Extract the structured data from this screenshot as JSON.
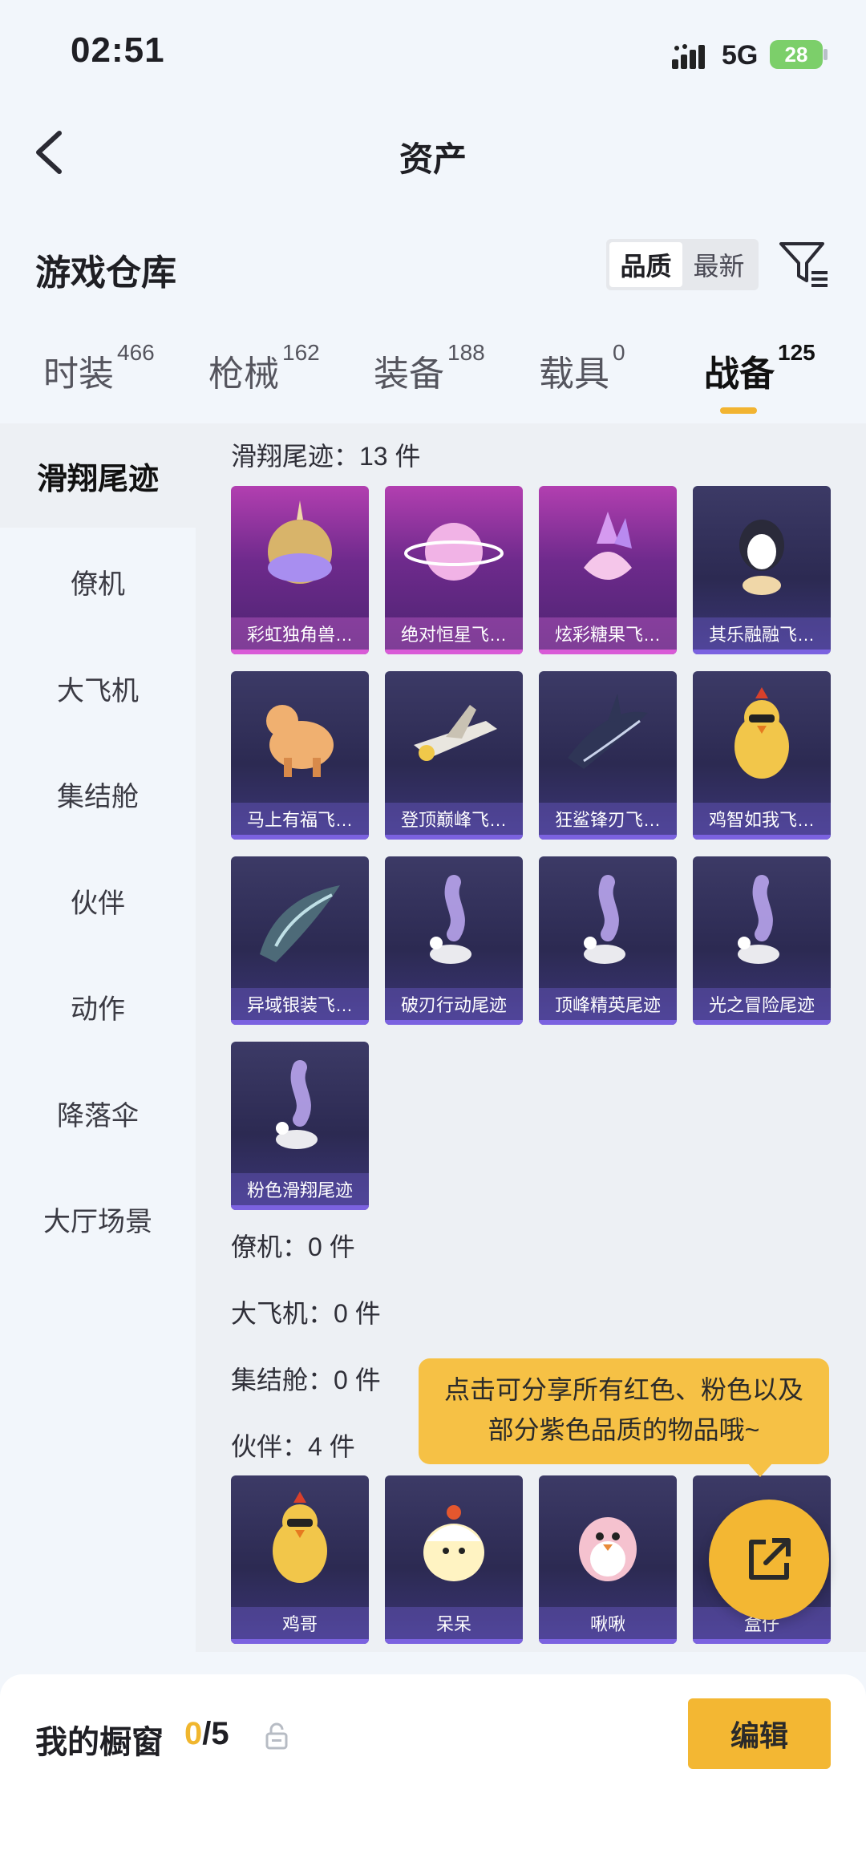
{
  "status": {
    "time": "02:51",
    "network": "5G",
    "battery": "28"
  },
  "nav": {
    "title": "资产"
  },
  "warehouse": {
    "title": "游戏仓库",
    "sort_quality": "品质",
    "sort_latest": "最新"
  },
  "tabs": [
    {
      "label": "时装",
      "count": "466"
    },
    {
      "label": "枪械",
      "count": "162"
    },
    {
      "label": "装备",
      "count": "188"
    },
    {
      "label": "载具",
      "count": "0"
    },
    {
      "label": "战备",
      "count": "125"
    }
  ],
  "sidebar": [
    "滑翔尾迹",
    "僚机",
    "大飞机",
    "集结舱",
    "伙伴",
    "动作",
    "降落伞",
    "大厅场景"
  ],
  "sections": {
    "trail_label": "滑翔尾迹：13 件",
    "wingman_label": "僚机：0 件",
    "plane_label": "大飞机：0 件",
    "pod_label": "集结舱：0 件",
    "partner_label": "伙伴：4 件"
  },
  "trail_items": [
    {
      "name": "彩虹独角兽…",
      "tier": "pink",
      "icon": "unicorn-emblem-icon"
    },
    {
      "name": "绝对恒星飞…",
      "tier": "pink",
      "icon": "planet-ring-icon"
    },
    {
      "name": "炫彩糖果飞…",
      "tier": "pink",
      "icon": "candy-crystal-icon"
    },
    {
      "name": "其乐融融飞…",
      "tier": "purple",
      "icon": "penguin-rocket-icon"
    },
    {
      "name": "马上有福飞…",
      "tier": "purple",
      "icon": "horse-toy-icon"
    },
    {
      "name": "登顶巅峰飞…",
      "tier": "purple",
      "icon": "jet-plane-icon"
    },
    {
      "name": "狂鲨锋刃飞…",
      "tier": "purple",
      "icon": "shark-glider-icon"
    },
    {
      "name": "鸡智如我飞…",
      "tier": "purple",
      "icon": "chicken-pilot-icon"
    },
    {
      "name": "异域银装飞…",
      "tier": "purple",
      "icon": "silver-wing-icon"
    },
    {
      "name": "破刃行动尾迹",
      "tier": "purple",
      "icon": "smoke-trail-icon"
    },
    {
      "name": "顶峰精英尾迹",
      "tier": "purple",
      "icon": "smoke-trail-icon"
    },
    {
      "name": "光之冒险尾迹",
      "tier": "purple",
      "icon": "smoke-trail-icon"
    },
    {
      "name": "粉色滑翔尾迹",
      "tier": "purple",
      "icon": "smoke-trail-icon"
    }
  ],
  "partner_items": [
    {
      "name": "鸡哥",
      "tier": "purple",
      "icon": "chicken-icon"
    },
    {
      "name": "呆呆",
      "tier": "purple",
      "icon": "chick-icon"
    },
    {
      "name": "啾啾",
      "tier": "purple",
      "icon": "pink-bird-icon"
    },
    {
      "name": "盒仔",
      "tier": "purple",
      "icon": "box-pet-icon"
    }
  ],
  "tooltip": {
    "line1": "点击可分享所有红色、粉色以及",
    "line2": "部分紫色品质的物品哦~"
  },
  "showcase": {
    "title": "我的橱窗",
    "current": "0",
    "total": "/5",
    "edit": "编辑"
  },
  "colors": {
    "accent": "#f3b733",
    "pink_tier": "#d95bd7",
    "purple_tier": "#7b62e0"
  }
}
